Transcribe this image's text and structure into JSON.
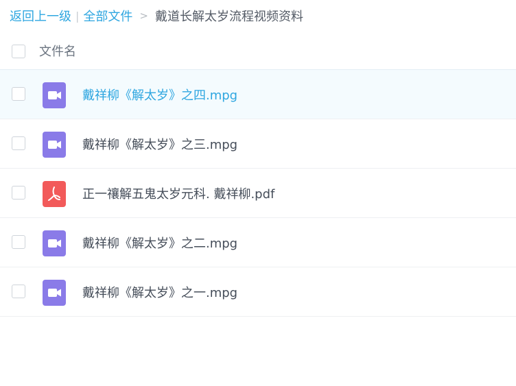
{
  "breadcrumb": {
    "back_label": "返回上一级",
    "separator": "|",
    "all_files_label": "全部文件",
    "arrow": ">",
    "current_folder": "戴道长解太岁流程视频资料"
  },
  "list_header": {
    "column_label": "文件名"
  },
  "colors": {
    "accent": "#2ea6e0",
    "video_icon": "#8a7be8",
    "pdf_icon": "#f25a5a"
  },
  "files": [
    {
      "name": "戴祥柳《解太岁》之四.mpg",
      "type": "video",
      "icon": "video-icon",
      "selected": true
    },
    {
      "name": "戴祥柳《解太岁》之三.mpg",
      "type": "video",
      "icon": "video-icon",
      "selected": false
    },
    {
      "name": "正一禳解五鬼太岁元科. 戴祥柳.pdf",
      "type": "pdf",
      "icon": "pdf-icon",
      "selected": false
    },
    {
      "name": "戴祥柳《解太岁》之二.mpg",
      "type": "video",
      "icon": "video-icon",
      "selected": false
    },
    {
      "name": "戴祥柳《解太岁》之一.mpg",
      "type": "video",
      "icon": "video-icon",
      "selected": false
    }
  ]
}
